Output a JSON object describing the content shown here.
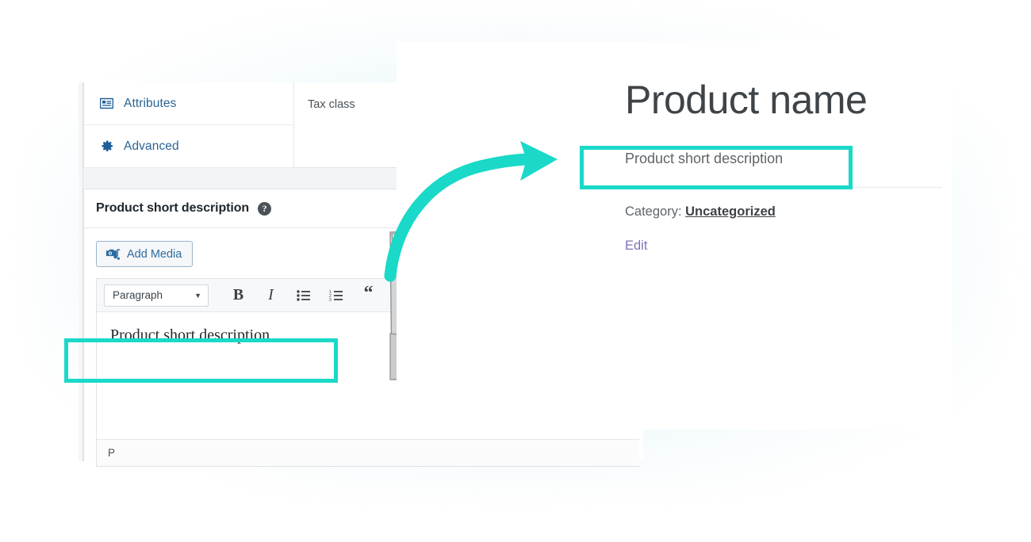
{
  "colors": {
    "teal_highlight": "#1ad9c8",
    "wp_blue": "#2a6496",
    "edit_link_purple": "#7e72b6",
    "glow_blue": "#b2e2ee"
  },
  "admin_window": {
    "product_data_tabs": [
      {
        "icon": "attributes-icon",
        "label": "Attributes"
      },
      {
        "icon": "gear-icon",
        "label": "Advanced"
      }
    ],
    "panel": {
      "field_label": "Tax class"
    },
    "short_description_box": {
      "title": "Product short description",
      "help_icon": "help-circle-icon",
      "add_media_label": "Add Media",
      "add_media_icon": "media-camera-note-icon",
      "toolbar": {
        "format_select_value": "Paragraph",
        "format_select_caret": "chevron-down-icon",
        "buttons": [
          {
            "name": "bold-button",
            "glyph": "B"
          },
          {
            "name": "italic-button",
            "glyph": "I"
          },
          {
            "name": "unordered-list-button",
            "glyph": "bullet-list-icon"
          },
          {
            "name": "ordered-list-button",
            "glyph": "numbered-list-icon"
          },
          {
            "name": "blockquote-button",
            "glyph": "“"
          }
        ]
      },
      "editor_content": "Product short description",
      "status_path": "P"
    }
  },
  "storefront_window": {
    "product_title": "Product name",
    "short_description": "Product short description",
    "category_label": "Category:",
    "category_value": "Uncategorized",
    "edit_label": "Edit"
  },
  "annotations": {
    "arrow": "curved-arrow-pointing-right",
    "highlight_editor_field": "Product short description",
    "highlight_storefront_field": "Product short description"
  }
}
